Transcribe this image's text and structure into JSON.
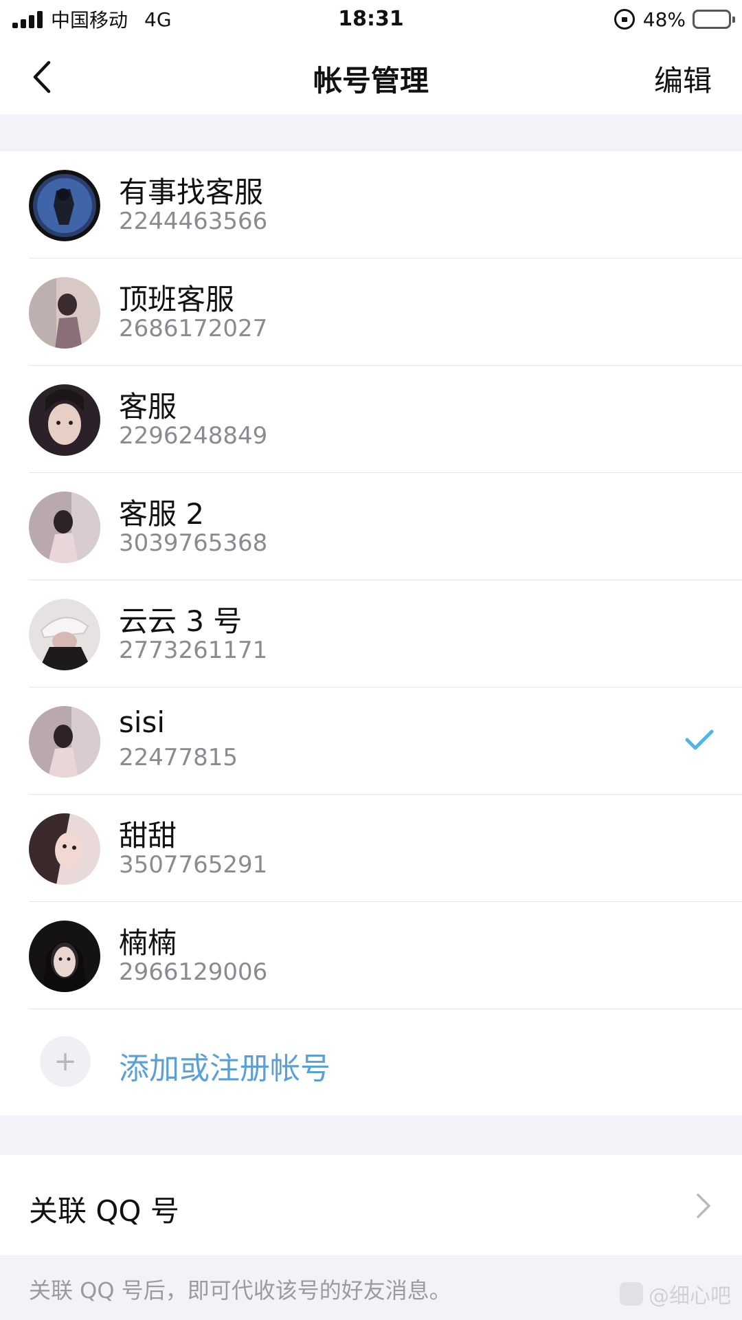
{
  "status_bar": {
    "carrier": "中国移动",
    "network": "4G",
    "time": "18:31",
    "battery": "48%"
  },
  "nav": {
    "title": "帐号管理",
    "edit_label": "编辑"
  },
  "accounts": [
    {
      "name": "有事找客服",
      "id": "2244463566",
      "selected": false
    },
    {
      "name": "顶班客服",
      "id": "2686172027",
      "selected": false
    },
    {
      "name": "客服",
      "id": "2296248849",
      "selected": false
    },
    {
      "name": "客服 2",
      "id": "3039765368",
      "selected": false
    },
    {
      "name": "云云 3 号",
      "id": "2773261171",
      "selected": false
    },
    {
      "name": "sisi",
      "id": "22477815",
      "selected": true
    },
    {
      "name": "甜甜",
      "id": "3507765291",
      "selected": false
    },
    {
      "name": "楠楠",
      "id": "2966129006",
      "selected": false
    }
  ],
  "add_account": {
    "label": "添加或注册帐号"
  },
  "qq_link": {
    "label": "关联 QQ 号",
    "footnote": "关联 QQ 号后，即可代收该号的好友消息。"
  },
  "watermark": "@细心吧",
  "colors": {
    "accent": "#5aa0d8",
    "check": "#4fb3e6",
    "background": "#f3f3f7"
  }
}
